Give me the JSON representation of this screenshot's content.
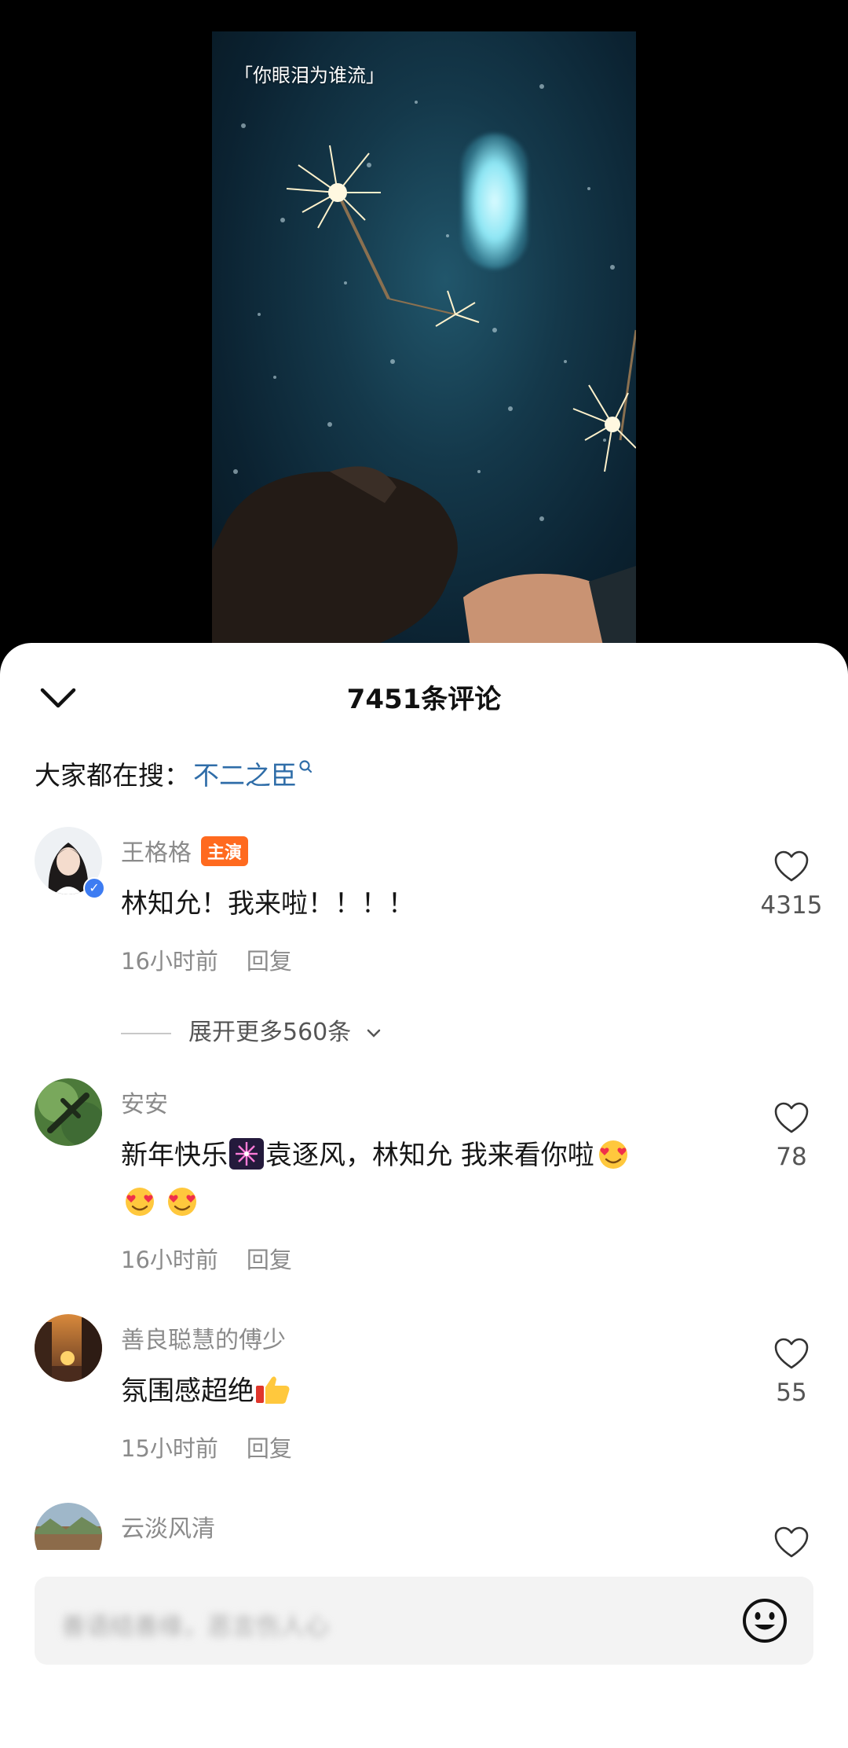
{
  "video": {
    "caption": "「你眼泪为谁流」"
  },
  "comments_panel": {
    "title": "7451条评论",
    "trending_label": "大家都在搜：",
    "trending_keyword": "不二之臣",
    "comments": [
      {
        "name": "王格格",
        "badge": "主演",
        "text": "林知允！我来啦！！！！",
        "time": "16小时前",
        "reply": "回复",
        "likes": "4315",
        "expand": "展开更多560条"
      },
      {
        "name": "安安",
        "text_1": "新年快乐",
        "text_2": "袁逐风，林知允 我来看你啦",
        "time": "16小时前",
        "reply": "回复",
        "likes": "78"
      },
      {
        "name": "善良聪慧的傅少",
        "text": "氛围感超绝",
        "time": "15小时前",
        "reply": "回复",
        "likes": "55"
      },
      {
        "name": "云淡风清"
      }
    ],
    "input_placeholder": "善语结善缘，恶言伤人心"
  },
  "icons": {
    "collapse": "chevron-down-icon",
    "search": "search-icon",
    "like": "heart-icon",
    "emoji": "smiley-icon",
    "fireworks": "fireworks-emoji",
    "heart_eyes": "heart-eyes-emoji",
    "thumbs_up": "thumbs-up-emoji"
  },
  "colors": {
    "badge": "#ff6a1f",
    "keyword": "#2f6da8",
    "verified": "#3d7cf2"
  }
}
